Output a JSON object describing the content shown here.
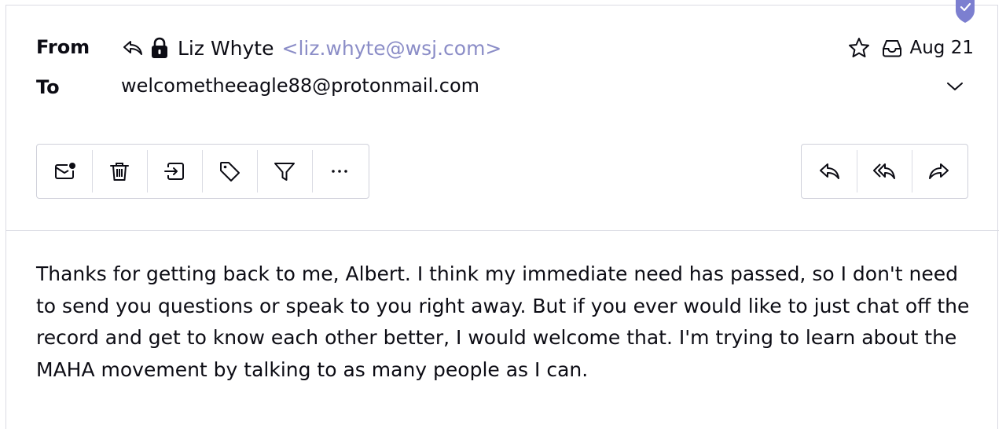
{
  "header": {
    "from_label": "From",
    "to_label": "To",
    "sender_name": "Liz Whyte",
    "sender_address": "<liz.whyte@wsj.com>",
    "recipient": "welcometheeagle88@protonmail.com",
    "date": "Aug 21",
    "icons": {
      "replied": "reply-icon",
      "encryption": "lock-icon",
      "star": "star-icon",
      "folder": "inbox-icon",
      "expand": "chevron-down-icon",
      "verified": "shield-check-icon"
    }
  },
  "toolbar": {
    "left": [
      {
        "name": "mark-unread-button",
        "icon": "envelope-dot-icon"
      },
      {
        "name": "delete-button",
        "icon": "trash-icon"
      },
      {
        "name": "move-button",
        "icon": "move-to-folder-icon"
      },
      {
        "name": "label-button",
        "icon": "tag-icon"
      },
      {
        "name": "filter-button",
        "icon": "filter-icon"
      },
      {
        "name": "more-button",
        "icon": "ellipsis-icon"
      }
    ],
    "right": [
      {
        "name": "reply-button",
        "icon": "reply-icon"
      },
      {
        "name": "reply-all-button",
        "icon": "reply-all-icon"
      },
      {
        "name": "forward-button",
        "icon": "forward-icon"
      }
    ]
  },
  "message": {
    "body": "Thanks for getting back to me, Albert. I think my immediate need has passed, so I don't need to send you questions or speak to you right away. But if you ever would like to just chat off the record and get to know each other better, I would welcome that. I'm trying to learn about the MAHA movement by talking to as many people as I can."
  },
  "colors": {
    "accent": "#8b8dc7",
    "border": "#dadbe3",
    "text": "#0c0c14",
    "badge": "#7c7fd0"
  }
}
